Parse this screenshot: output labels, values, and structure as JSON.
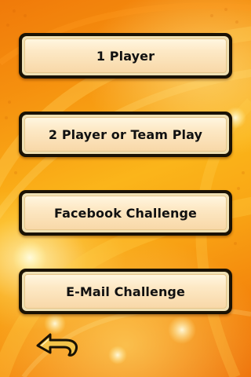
{
  "menu": {
    "items": [
      {
        "label": "1 Player"
      },
      {
        "label": "2 Player or Team Play"
      },
      {
        "label": "Facebook Challenge"
      },
      {
        "label": "E-Mail Challenge"
      }
    ]
  },
  "navigation": {
    "back_icon": "back-arrow-icon"
  },
  "colors": {
    "background_orange": "#f58f0e",
    "background_yellow": "#fbb51a",
    "button_face": "#fde9c6",
    "button_border": "#1a1204",
    "label_text": "#111111",
    "back_arrow_fill": "#f4c44a"
  }
}
